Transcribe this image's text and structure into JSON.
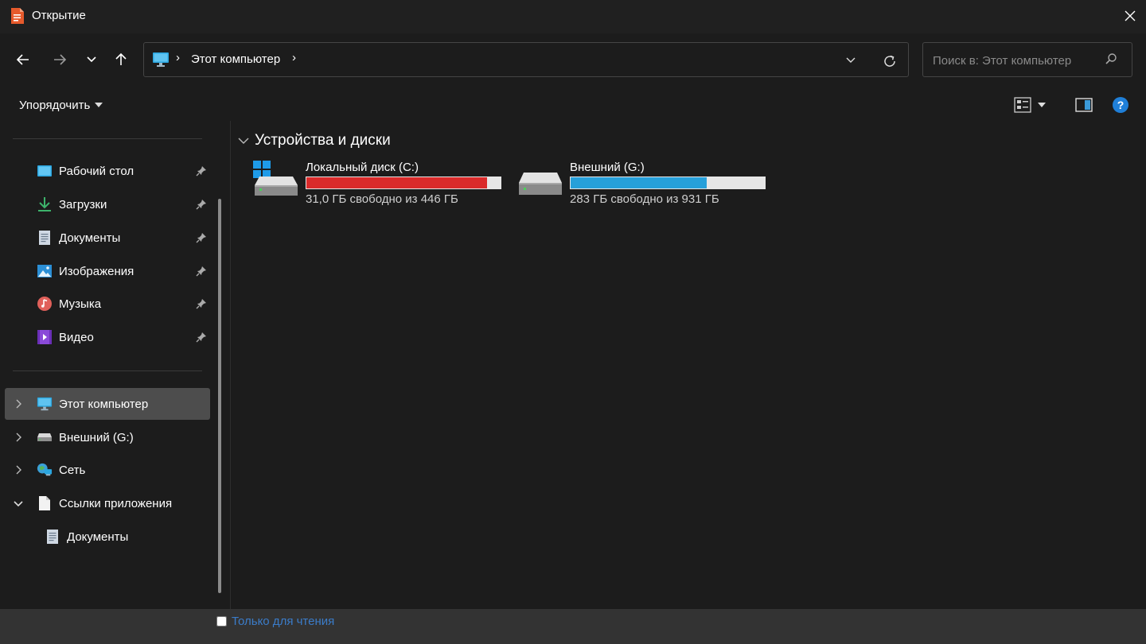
{
  "window": {
    "title": "Открытие",
    "close_icon": "close-icon"
  },
  "nav": {
    "back_icon": "arrow-left-icon",
    "forward_icon": "arrow-right-icon",
    "recent_icon": "chevron-down-icon",
    "up_icon": "arrow-up-icon"
  },
  "address": {
    "location_icon": "computer-icon",
    "separator": "›",
    "path": "Этот компьютер",
    "trailing_separator": "›"
  },
  "search": {
    "placeholder": "Поиск в: Этот компьютер"
  },
  "toolbar": {
    "sort_label": "Упорядочить"
  },
  "quick_access": [
    {
      "label": "Рабочий стол",
      "icon": "desktop-icon",
      "pinned": true
    },
    {
      "label": "Загрузки",
      "icon": "download-icon",
      "pinned": true
    },
    {
      "label": "Документы",
      "icon": "document-icon",
      "pinned": true
    },
    {
      "label": "Изображения",
      "icon": "pictures-icon",
      "pinned": true
    },
    {
      "label": "Музыка",
      "icon": "music-icon",
      "pinned": true
    },
    {
      "label": "Видео",
      "icon": "video-icon",
      "pinned": true
    }
  ],
  "tree": [
    {
      "label": "Этот компьютер",
      "icon": "computer-icon",
      "expanded": false,
      "selected": true
    },
    {
      "label": "Внешний (G:)",
      "icon": "drive-icon",
      "expanded": false,
      "selected": false
    },
    {
      "label": "Сеть",
      "icon": "network-icon",
      "expanded": false,
      "selected": false
    },
    {
      "label": "Ссылки приложения",
      "icon": "file-icon",
      "expanded": true,
      "selected": false
    },
    {
      "label": "Документы",
      "icon": "document-icon",
      "child": true
    }
  ],
  "main": {
    "group_title": "Устройства и диски",
    "drives": [
      {
        "name": "Локальный диск (C:)",
        "free_text": "31,0 ГБ свободно из 446 ГБ",
        "used_fraction": 0.93,
        "bar_color": "#da2a2a",
        "icon": "system-drive-icon"
      },
      {
        "name": "Внешний (G:)",
        "free_text": "283 ГБ свободно из 931 ГБ",
        "used_fraction": 0.7,
        "bar_color": "#26a0da",
        "icon": "drive-icon"
      }
    ]
  },
  "footer": {
    "readonly_label": "Только для чтения",
    "readonly_checked": false
  }
}
